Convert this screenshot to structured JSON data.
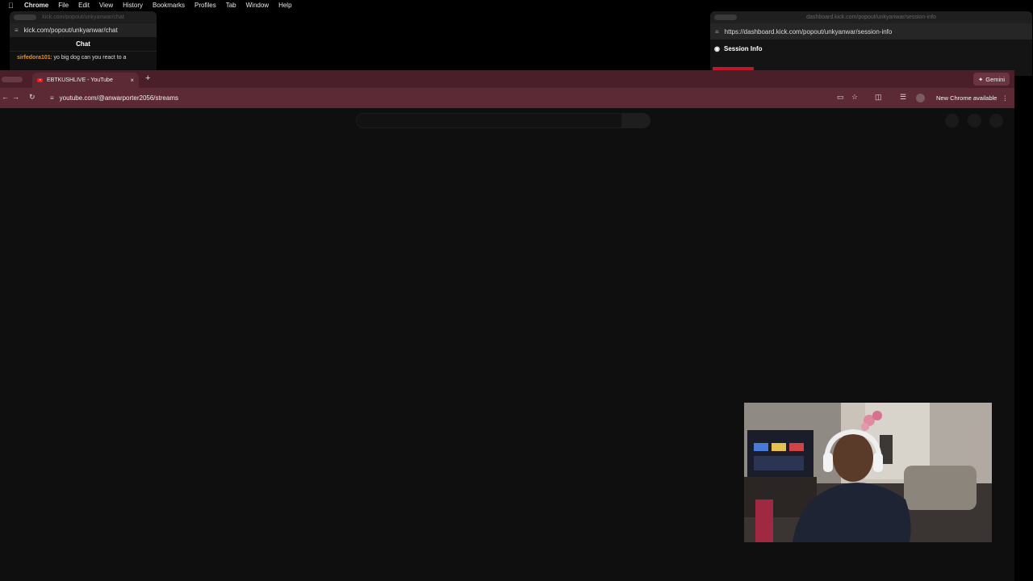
{
  "menubar": {
    "app": "Chrome",
    "items": [
      "File",
      "Edit",
      "View",
      "History",
      "Bookmarks",
      "Profiles",
      "Tab",
      "Window",
      "Help"
    ]
  },
  "chat_window": {
    "title": "kick.com/popout/unkyanwar/chat",
    "url": "kick.com/popout/unkyanwar/chat",
    "header": "Chat",
    "message_user": "sirfedora101",
    "message_text": ": yo big dog can you react to a"
  },
  "session_window": {
    "title": "dashboard.kick.com/popout/unkyanwar/session-info",
    "url": "https://dashboard.kick.com/popout/unkyanwar/session-info",
    "header": "Session Info"
  },
  "browser": {
    "tab_title": "EBTKUSHLIVE - YouTube",
    "tab_close": "×",
    "new_tab": "+",
    "gemini_label": "Gemini",
    "url": "youtube.com/@anwarporter2056/streams",
    "update_label": "New Chrome available",
    "accent": "#5c2a35"
  },
  "icons": [
    "apple-icon",
    "youtube-icon",
    "back-icon",
    "forward-icon",
    "reload-icon",
    "site-settings-icon",
    "install-icon",
    "bookmark-star-icon",
    "side-panel-icon",
    "media-icon",
    "profile-avatar-icon",
    "more-icon",
    "gemini-icon"
  ]
}
